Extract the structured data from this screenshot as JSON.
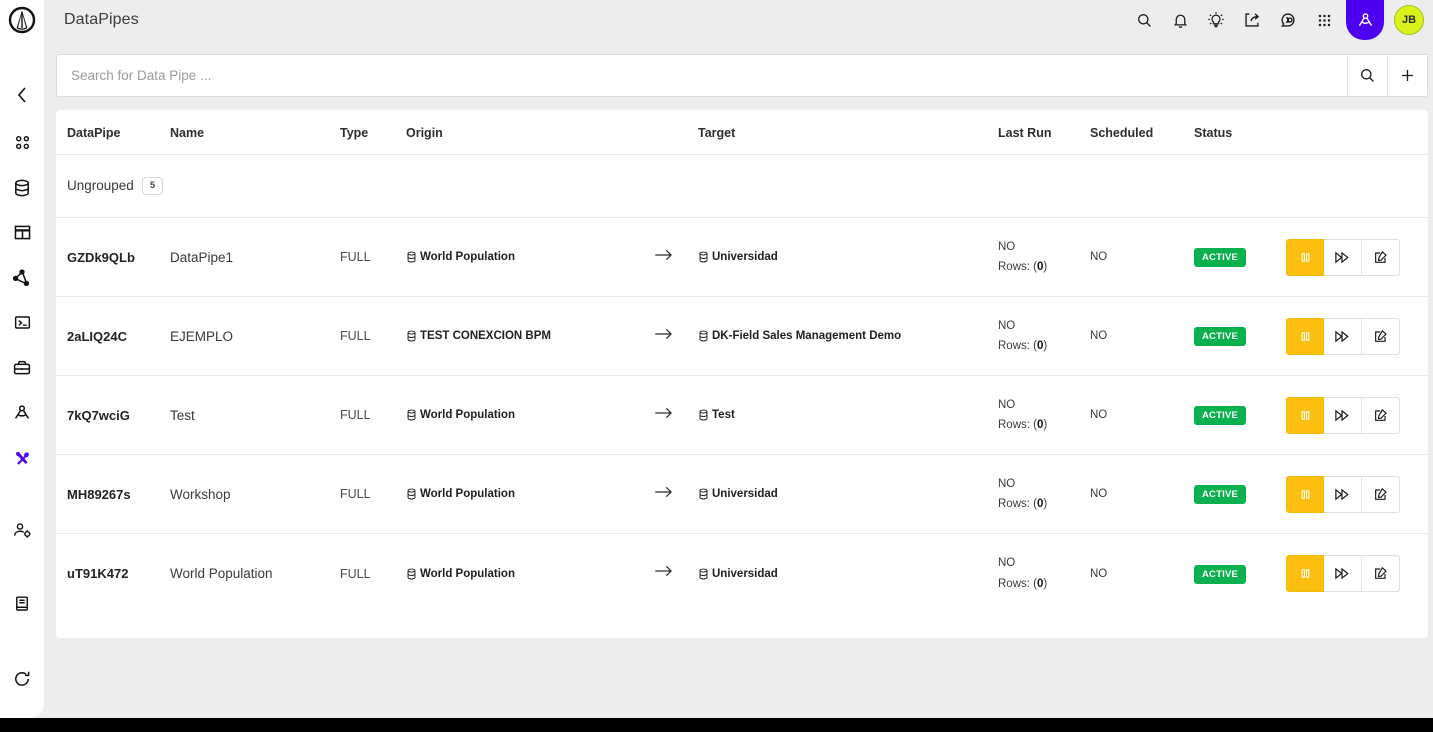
{
  "app": {
    "logo_icon": "anaplan-logo-icon",
    "title": "DataPipes",
    "background_color": "#ededed",
    "accent_purple": "#4d00f0",
    "accent_yellow": "#fcbf10",
    "accent_green": "#0bb14c",
    "avatar_color": "#dbf21a"
  },
  "sidebar": {
    "collapse_icon": "chevron-left-icon",
    "items": [
      {
        "icon": "apps-grid-icon",
        "active": false
      },
      {
        "icon": "database-icon",
        "active": false
      },
      {
        "icon": "table-icon",
        "active": false
      },
      {
        "icon": "share-nodes-icon",
        "active": false
      },
      {
        "icon": "terminal-icon",
        "active": false
      },
      {
        "icon": "toolbox-icon",
        "active": false
      },
      {
        "icon": "compass-user-icon",
        "active": false
      },
      {
        "icon": "tools-wrench-icon",
        "active": true
      },
      {
        "icon": "user-settings-icon",
        "active": false
      },
      {
        "icon": "book-icon",
        "active": false
      },
      {
        "icon": "refresh-icon",
        "active": false
      }
    ]
  },
  "header": {
    "title": "DataPipes",
    "actions": [
      {
        "icon": "search-icon",
        "label": "Search"
      },
      {
        "icon": "bell-icon",
        "label": "Notifications"
      },
      {
        "icon": "lightbulb-icon",
        "label": "Ideas"
      },
      {
        "icon": "share-export-icon",
        "label": "Share"
      },
      {
        "icon": "help-circle-icon",
        "label": "Help"
      },
      {
        "icon": "apps-dots-icon",
        "label": "Apps"
      },
      {
        "icon": "compass-user-icon",
        "label": "Workspace"
      }
    ],
    "avatar_initials": "JB"
  },
  "search": {
    "value": "",
    "placeholder": "Search for Data Pipe ...",
    "search_icon": "search-icon",
    "add_icon": "plus-icon"
  },
  "table": {
    "columns": [
      "DataPipe",
      "Name",
      "Type",
      "Origin",
      "",
      "Target",
      "Last Run",
      "Scheduled",
      "Status",
      ""
    ],
    "group": {
      "label": "Ungrouped",
      "count": "5"
    },
    "rows": [
      {
        "datapipe": "GZDk9QLb",
        "name": "DataPipe1",
        "type": "FULL",
        "origin": "World Population",
        "arrow": "arrow-right-icon",
        "target": "Universidad",
        "last_run": "NO",
        "rows_label": "Rows: (",
        "rows_value": "0",
        "rows_close": ")",
        "scheduled": "NO",
        "status": "ACTIVE",
        "actions": [
          "pause-icon",
          "fast-forward-icon",
          "edit-icon"
        ]
      },
      {
        "datapipe": "2aLIQ24C",
        "name": "EJEMPLO",
        "type": "FULL",
        "origin": "TEST CONEXCION BPM",
        "arrow": "arrow-right-icon",
        "target": "DK-Field Sales Management Demo",
        "last_run": "NO",
        "rows_label": "Rows: (",
        "rows_value": "0",
        "rows_close": ")",
        "scheduled": "NO",
        "status": "ACTIVE",
        "actions": [
          "pause-icon",
          "fast-forward-icon",
          "edit-icon"
        ]
      },
      {
        "datapipe": "7kQ7wciG",
        "name": "Test",
        "type": "FULL",
        "origin": "World Population",
        "arrow": "arrow-right-icon",
        "target": "Test",
        "last_run": "NO",
        "rows_label": "Rows: (",
        "rows_value": "0",
        "rows_close": ")",
        "scheduled": "NO",
        "status": "ACTIVE",
        "actions": [
          "pause-icon",
          "fast-forward-icon",
          "edit-icon"
        ]
      },
      {
        "datapipe": "MH89267s",
        "name": "Workshop",
        "type": "FULL",
        "origin": "World Population",
        "arrow": "arrow-right-icon",
        "target": "Universidad",
        "last_run": "NO",
        "rows_label": "Rows: (",
        "rows_value": "0",
        "rows_close": ")",
        "scheduled": "NO",
        "status": "ACTIVE",
        "actions": [
          "pause-icon",
          "fast-forward-icon",
          "edit-icon"
        ]
      },
      {
        "datapipe": "uT91K472",
        "name": "World Population",
        "type": "FULL",
        "origin": "World Population",
        "arrow": "arrow-right-icon",
        "target": "Universidad",
        "last_run": "NO",
        "rows_label": "Rows: (",
        "rows_value": "0",
        "rows_close": ")",
        "scheduled": "NO",
        "status": "ACTIVE",
        "actions": [
          "pause-icon",
          "fast-forward-icon",
          "edit-icon"
        ]
      }
    ]
  }
}
